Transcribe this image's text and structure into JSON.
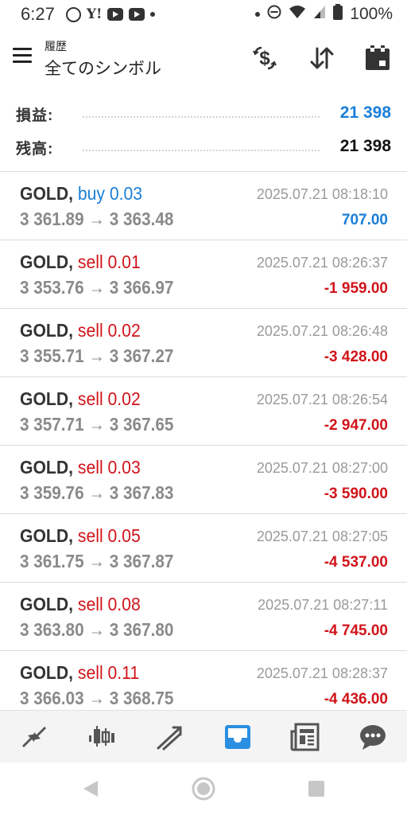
{
  "status": {
    "time": "6:27",
    "battery": "100%"
  },
  "header": {
    "subtitle": "履歴",
    "title": "全てのシンボル",
    "icons": [
      "dollar-exchange-icon",
      "sort-icon",
      "calendar-icon"
    ]
  },
  "summary": {
    "profit_label": "損益:",
    "profit_value": "21 398",
    "balance_label": "残高:",
    "balance_value": "21 398"
  },
  "trades": [
    {
      "symbol": "GOLD,",
      "side": "buy 0.03",
      "prices": "3 361.89 → 3 363.48",
      "time": "2025.07.21 08:18:10",
      "profit": "707.00"
    },
    {
      "symbol": "GOLD,",
      "side": "sell 0.01",
      "prices": "3 353.76 → 3 366.97",
      "time": "2025.07.21 08:26:37",
      "profit": "-1 959.00"
    },
    {
      "symbol": "GOLD,",
      "side": "sell 0.02",
      "prices": "3 355.71 → 3 367.27",
      "time": "2025.07.21 08:26:48",
      "profit": "-3 428.00"
    },
    {
      "symbol": "GOLD,",
      "side": "sell 0.02",
      "prices": "3 357.71 → 3 367.65",
      "time": "2025.07.21 08:26:54",
      "profit": "-2 947.00"
    },
    {
      "symbol": "GOLD,",
      "side": "sell 0.03",
      "prices": "3 359.76 → 3 367.83",
      "time": "2025.07.21 08:27:00",
      "profit": "-3 590.00"
    },
    {
      "symbol": "GOLD,",
      "side": "sell 0.05",
      "prices": "3 361.75 → 3 367.87",
      "time": "2025.07.21 08:27:05",
      "profit": "-4 537.00"
    },
    {
      "symbol": "GOLD,",
      "side": "sell 0.08",
      "prices": "3 363.80 → 3 367.80",
      "time": "2025.07.21 08:27:11",
      "profit": "-4 745.00"
    },
    {
      "symbol": "GOLD,",
      "side": "sell 0.11",
      "prices": "3 366.03 → 3 368.75",
      "time": "2025.07.21 08:28:37",
      "profit": "-4 436.00"
    }
  ],
  "nav": [
    "quotes-icon",
    "chart-icon",
    "trade-icon",
    "history-icon",
    "news-icon",
    "chat-icon"
  ],
  "colors": {
    "buy": "#1a7fd8",
    "sell": "#d0141a",
    "active_nav": "#2a8fe0"
  }
}
